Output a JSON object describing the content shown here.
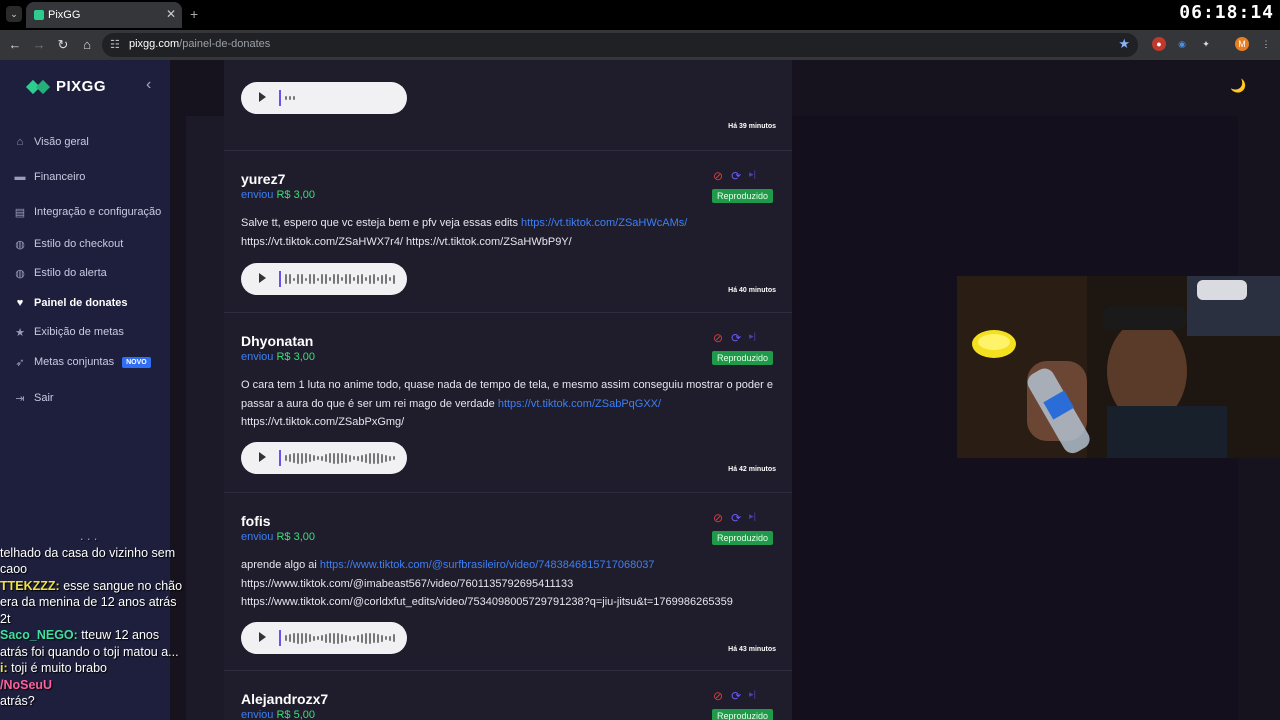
{
  "browser": {
    "tab_title": "PixGG",
    "url_host": "pixgg.com",
    "url_path": "/painel-de-donates",
    "clock": "06:18:14"
  },
  "sidebar": {
    "logo": "PIXGG",
    "items": [
      {
        "label": "Visão geral",
        "icon": "home-icon"
      },
      {
        "label": "Financeiro",
        "icon": "wallet-icon"
      },
      {
        "label": "Integração e configuração",
        "icon": "integration-icon"
      },
      {
        "label": "Estilo do checkout",
        "icon": "palette-icon"
      },
      {
        "label": "Estilo do alerta",
        "icon": "palette-icon"
      },
      {
        "label": "Painel de donates",
        "icon": "donate-icon"
      },
      {
        "label": "Exibição de metas",
        "icon": "star-icon"
      },
      {
        "label": "Metas conjuntas",
        "icon": "rocket-icon",
        "badge": "NOVO"
      },
      {
        "label": "Sair",
        "icon": "logout-icon"
      }
    ]
  },
  "chat": [
    {
      "user": "",
      "text": ". . ."
    },
    {
      "user": "",
      "text": "telhado da casa do vizinho sem caoo"
    },
    {
      "user": "TTEKZZZ:",
      "text": "esse sangue no chão era da menina de 12 anos atrás 2t"
    },
    {
      "user": "Saco_NEGO:",
      "text": "tteuw 12 anos atrás foi quando o toji matou a..."
    },
    {
      "user": "i:",
      "text": "toji é muito brabo"
    },
    {
      "user": "/NoSeuU",
      "text": ""
    },
    {
      "user": "",
      "text": "atrás?"
    }
  ],
  "donations": [
    {
      "name": "",
      "sent": "",
      "amount": "",
      "status": "",
      "message": "",
      "links": [],
      "time": "Há 39 minutos"
    },
    {
      "name": "yurez7",
      "sent": "enviou",
      "amount": "R$ 3,00",
      "status": "Reproduzido",
      "message": "Salve tt, espero que vc esteja bem e pfv veja essas edits ",
      "link": "https://vt.tiktok.com/ZSaHWcAMs/",
      "message_after": "https://vt.tiktok.com/ZSaHWX7r4/ https://vt.tiktok.com/ZSaHWbP9Y/",
      "time": "Há 40 minutos"
    },
    {
      "name": "Dhyonatan",
      "sent": "enviou",
      "amount": "R$ 3,00",
      "status": "Reproduzido",
      "message": "O cara tem 1 luta no anime todo, quase nada de tempo de tela, e mesmo assim conseguiu mostrar o poder e passar a aura do que é ser um rei mago de verdade ",
      "link": "https://vt.tiktok.com/ZSabPqGXX/",
      "message_after": "https://vt.tiktok.com/ZSabPxGmg/",
      "time": "Há 42 minutos"
    },
    {
      "name": "fofis",
      "sent": "enviou",
      "amount": "R$ 3,00",
      "status": "Reproduzido",
      "message": "aprende algo ai ",
      "link": "https://www.tiktok.com/@surfbrasileiro/video/7483846815717068037",
      "message_after": "https://www.tiktok.com/@imabeast567/video/7601135792695411133 https://www.tiktok.com/@corldxfut_edits/video/7534098005729791238?q=jiu-jitsu&t=1769986265359",
      "time": "Há 43 minutos"
    },
    {
      "name": "Alejandrozx7",
      "sent": "enviou",
      "amount": "R$ 5,00",
      "status": "Reproduzido",
      "message": "",
      "link": "",
      "message_after": "",
      "time": ""
    }
  ]
}
